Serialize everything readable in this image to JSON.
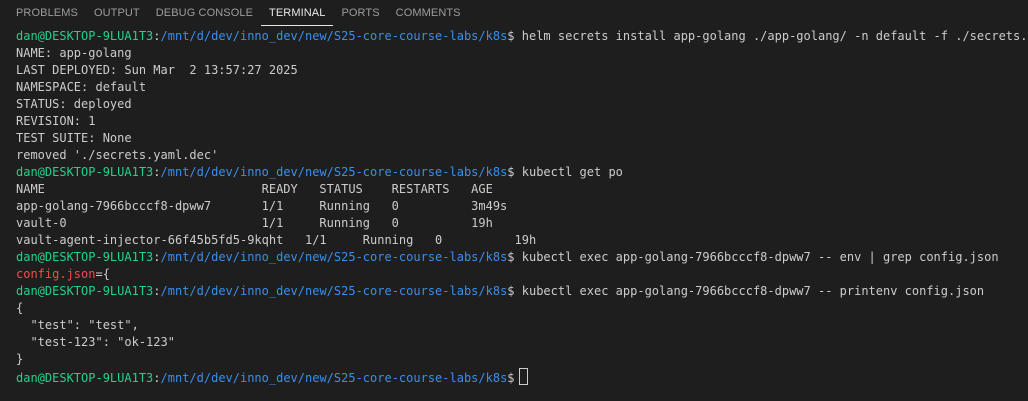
{
  "tabs": [
    {
      "label": "PROBLEMS"
    },
    {
      "label": "OUTPUT"
    },
    {
      "label": "DEBUG CONSOLE"
    },
    {
      "label": "TERMINAL"
    },
    {
      "label": "PORTS"
    },
    {
      "label": "COMMENTS"
    }
  ],
  "active_tab": "TERMINAL",
  "prompt": {
    "user_host": "dan@DESKTOP-9LUA1T3",
    "separator": ":",
    "path": "/mnt/d/dev/inno_dev/new/S25-core-course-labs/k8s",
    "symbol": "$"
  },
  "terminal": {
    "cmd1": " helm secrets install app-golang ./app-golang/ -n default -f ./secrets.yaml",
    "helm_output": [
      "NAME: app-golang",
      "LAST DEPLOYED: Sun Mar  2 13:57:27 2025",
      "NAMESPACE: default",
      "STATUS: deployed",
      "REVISION: 1",
      "TEST SUITE: None",
      "removed './secrets.yaml.dec'"
    ],
    "cmd2": " kubectl get po",
    "pods_header": "NAME                              READY   STATUS    RESTARTS   AGE",
    "pods": [
      "app-golang-7966bcccf8-dpww7       1/1     Running   0          3m49s",
      "vault-0                           1/1     Running   0          19h",
      "vault-agent-injector-66f45b5fd5-9kqht   1/1     Running   0          19h"
    ],
    "cmd3": " kubectl exec app-golang-7966bcccf8-dpww7 -- env | grep config.json",
    "grep_match": "config.json",
    "grep_rest": "={",
    "cmd4": " kubectl exec app-golang-7966bcccf8-dpww7 -- printenv config.json",
    "json_output": [
      "{",
      "  \"test\": \"test\",",
      "  \"test-123\": \"ok-123\"",
      "}"
    ]
  },
  "colors": {
    "background": "#1e1e1e",
    "prompt_user": "#23d18b",
    "prompt_path": "#3b8eea",
    "grep_highlight": "#f14c4c",
    "text": "#cccccc"
  }
}
